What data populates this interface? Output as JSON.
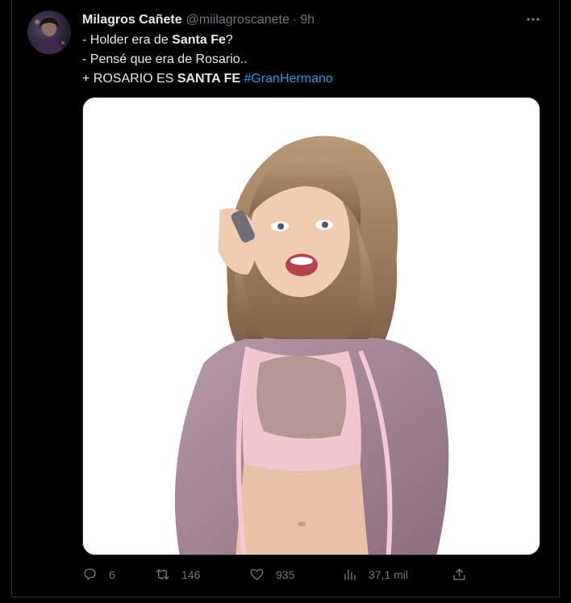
{
  "tweet": {
    "display_name": "Milagros Cañete",
    "handle": "@miilagroscanete",
    "separator": "·",
    "time": "9h",
    "lines": [
      {
        "pre": "- Holder era de ",
        "bold": "Santa Fe",
        "post": "?"
      },
      {
        "pre": "- Pensé que era de Rosario..",
        "bold": "",
        "post": ""
      },
      {
        "pre": "+ ROSARIO ES ",
        "bold": "SANTA FE",
        "post": " ",
        "hashtag": "#GranHermano"
      }
    ]
  },
  "actions": {
    "reply_count": "6",
    "retweet_count": "146",
    "like_count": "935",
    "views_count": "37,1 mil"
  },
  "icons": {
    "more": "more-horizontal-icon",
    "reply": "reply-icon",
    "retweet": "retweet-icon",
    "like": "heart-icon",
    "views": "views-icon",
    "share": "share-icon"
  },
  "colors": {
    "background": "#000000",
    "text_primary": "#e7e9ea",
    "text_secondary": "#71767b",
    "hashtag": "#1d9bf0"
  }
}
